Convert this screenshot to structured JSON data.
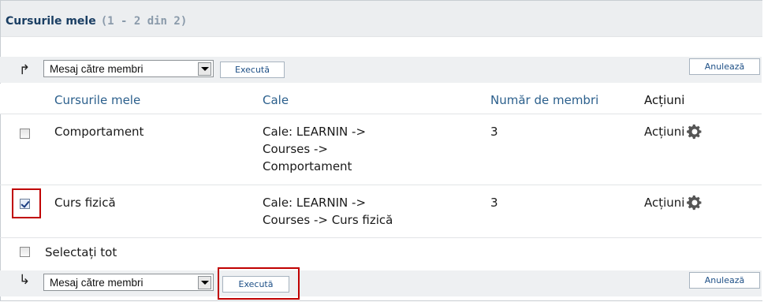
{
  "header": {
    "title": "Cursurile mele",
    "count": "(1 - 2 din 2)"
  },
  "toolbar": {
    "select_label": "Mesaj către membri",
    "execute_label": "Execută",
    "cancel_label": "Anulează",
    "top_arrow": "↱",
    "bottom_arrow": "↳"
  },
  "table": {
    "columns": [
      "Cursurile mele",
      "Cale",
      "Număr de membri",
      "Acțiuni"
    ],
    "rows": [
      {
        "checked": false,
        "name": "Comportament",
        "path": [
          "Cale: LEARNIN ->",
          "Courses ->",
          "Comportament"
        ],
        "members": "3",
        "actions": "Acțiuni"
      },
      {
        "checked": true,
        "name": "Curs fizică",
        "path": [
          "Cale: LEARNIN ->",
          "Courses -> Curs fizică"
        ],
        "members": "3",
        "actions": "Acțiuni"
      }
    ],
    "select_all": "Selectați tot"
  },
  "icons": {
    "gear": "gear-icon",
    "dropdown": "chevron-down-icon"
  },
  "colors": {
    "link_blue": "#2b5f8c",
    "title_blue": "#1a3e63",
    "highlight_red": "#c00000"
  }
}
